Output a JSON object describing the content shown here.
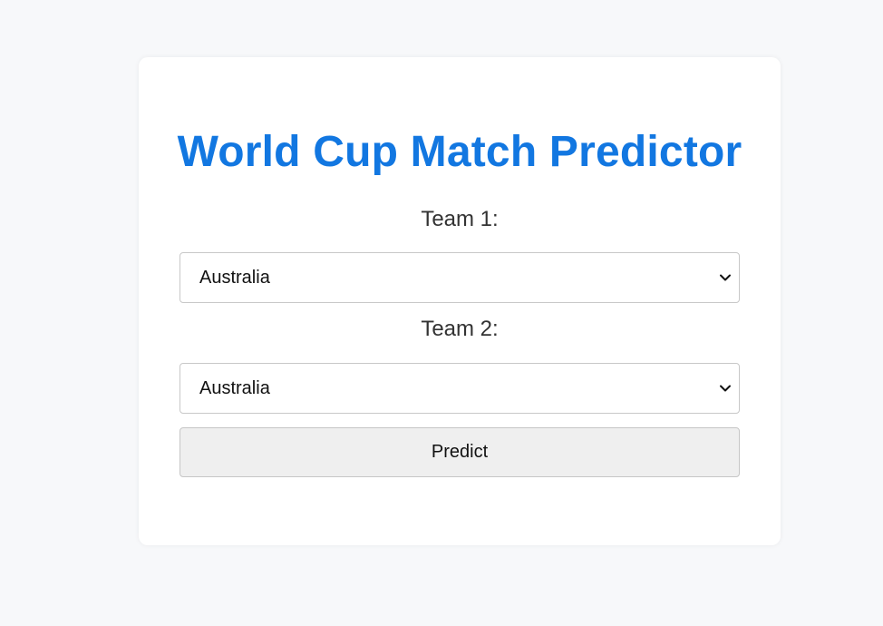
{
  "app": {
    "title": "World Cup Match Predictor"
  },
  "form": {
    "team1": {
      "label": "Team 1:",
      "selected": "Australia"
    },
    "team2": {
      "label": "Team 2:",
      "selected": "Australia"
    },
    "submit_label": "Predict"
  },
  "colors": {
    "accent": "#1277e1",
    "background": "#f7f8fa",
    "card": "#ffffff",
    "button": "#efefef"
  },
  "icons": {
    "dropdown": "chevron-down-icon"
  }
}
